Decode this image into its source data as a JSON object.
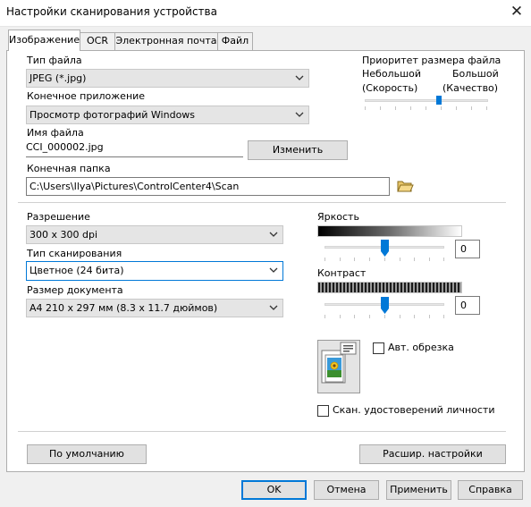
{
  "window": {
    "title": "Настройки сканирования устройства",
    "close_glyph": "✕"
  },
  "tabs": [
    {
      "label": "Изображение",
      "active": true
    },
    {
      "label": "OCR",
      "active": false
    },
    {
      "label": "Электронная почта",
      "active": false
    },
    {
      "label": "Файл",
      "active": false
    }
  ],
  "file_type": {
    "label": "Тип файла",
    "value": "JPEG (*.jpg)"
  },
  "target_app": {
    "label": "Конечное приложение",
    "value": "Просмотр фотографий Windows"
  },
  "file_name": {
    "label": "Имя файла",
    "value": "CCI_000002.jpg",
    "change_button": "Изменить"
  },
  "dest_folder": {
    "label": "Конечная папка",
    "value": "C:\\Users\\Ilya\\Pictures\\ControlCenter4\\Scan"
  },
  "file_size_priority": {
    "label": "Приоритет размера файла",
    "small_label": "Небольшой",
    "small_sub": "(Скорость)",
    "large_label": "Большой",
    "large_sub": "(Качество)",
    "level_percent": 60
  },
  "resolution": {
    "label": "Разрешение",
    "value": "300 x 300  dpi"
  },
  "scan_type": {
    "label": "Тип сканирования",
    "value": "Цветное (24 бита)"
  },
  "document_size": {
    "label": "Размер документа",
    "value": "A4 210 x 297 мм (8.3 x 11.7 дюймов)"
  },
  "brightness": {
    "label": "Яркость",
    "value": "0",
    "level_percent": 50
  },
  "contrast": {
    "label": "Контраст",
    "value": "0",
    "level_percent": 50
  },
  "auto_crop": {
    "label": "Авт. обрезка",
    "checked": false
  },
  "id_scan": {
    "label": "Скан. удостоверений личности",
    "checked": false
  },
  "panel_buttons": {
    "default": "По умолчанию",
    "advanced": "Расшир. настройки"
  },
  "dialog_buttons": {
    "ok": "OK",
    "cancel": "Отмена",
    "apply": "Применить",
    "help": "Справка"
  },
  "colors": {
    "accent": "#0078d7",
    "button_face": "#e1e1e1",
    "combo_face": "#e5e5e5"
  }
}
